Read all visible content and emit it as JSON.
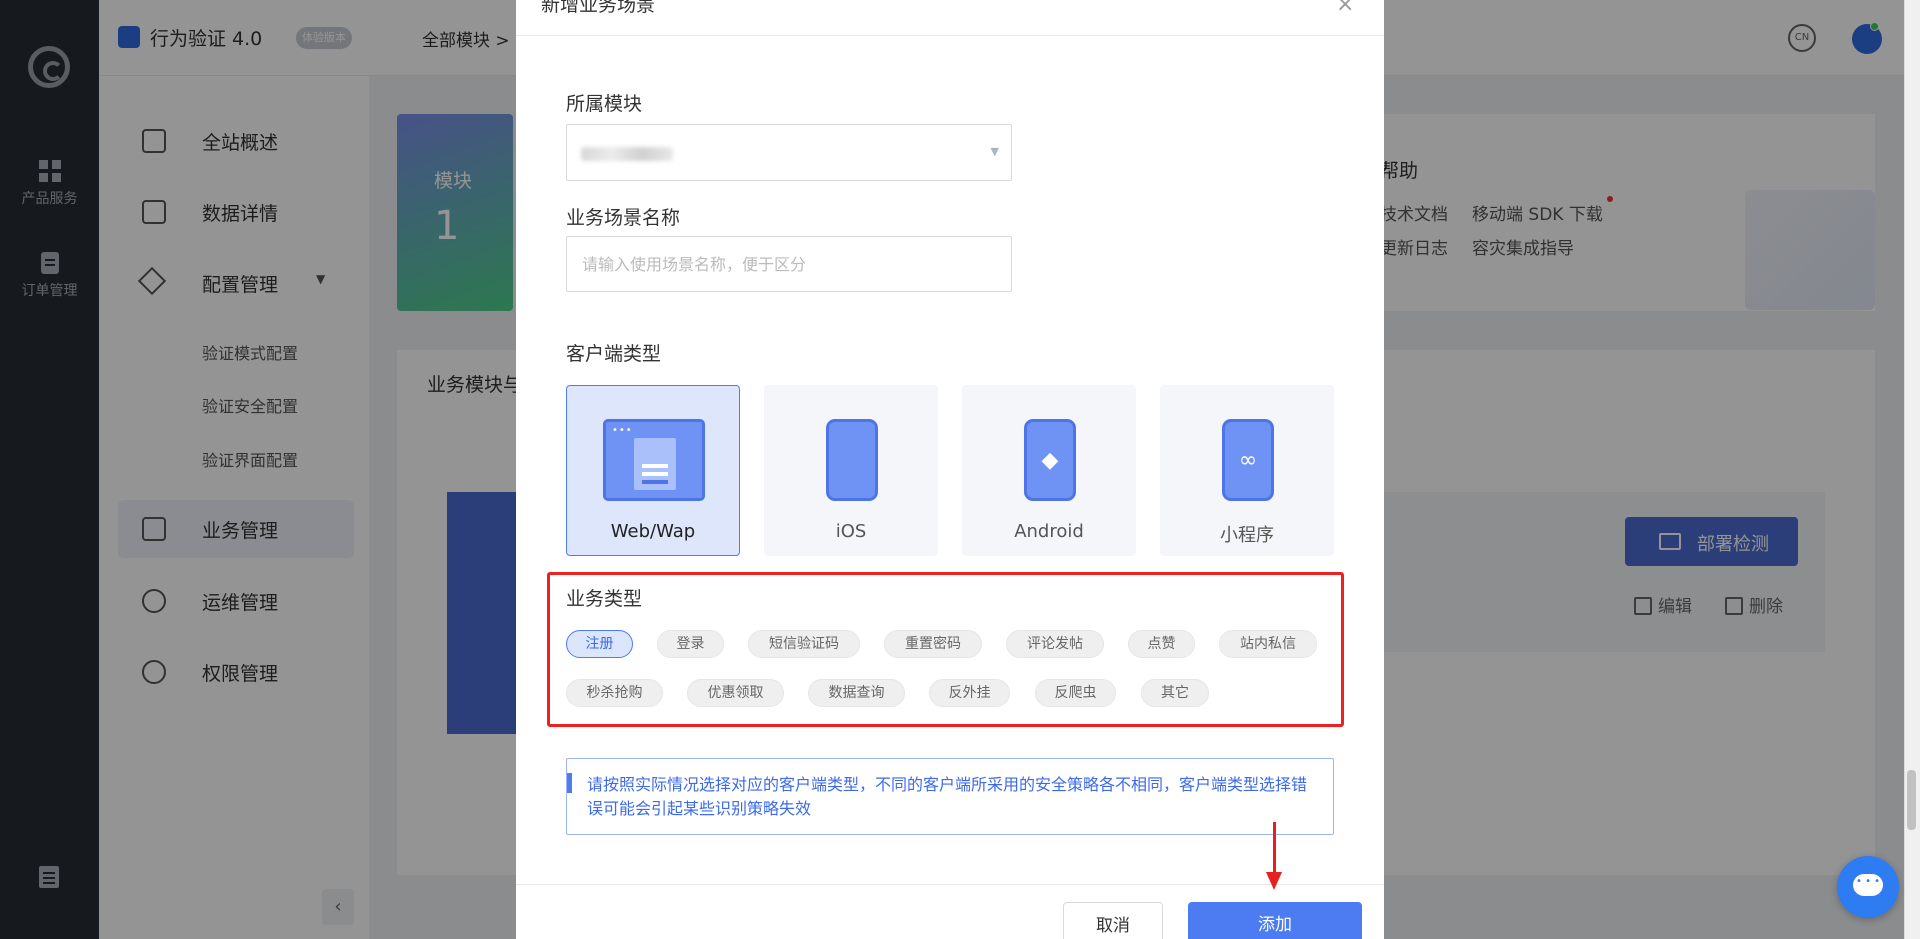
{
  "rail": {
    "items": [
      {
        "label": "产品服务",
        "icon": "grid-icon"
      },
      {
        "label": "订单管理",
        "icon": "clipboard-icon"
      }
    ]
  },
  "header": {
    "brand_title": "行为验证 4.0",
    "brand_badge": "体验版本",
    "breadcrumb": "全部模块 >",
    "lang_label": "CN"
  },
  "sidebar": {
    "items": [
      {
        "label": "全站概述",
        "icon": "overview-icon"
      },
      {
        "label": "数据详情",
        "icon": "chart-image-icon"
      },
      {
        "label": "配置管理",
        "icon": "triangle-config-icon"
      },
      {
        "label": "业务管理",
        "icon": "archive-box-icon"
      },
      {
        "label": "运维管理",
        "icon": "gear-icon"
      },
      {
        "label": "权限管理",
        "icon": "shield-icon"
      }
    ],
    "sub_items": [
      "验证模式配置",
      "验证安全配置",
      "验证界面配置"
    ],
    "collapse_label": "‹"
  },
  "background": {
    "stat_label": "模块",
    "stat_value": "1",
    "help_title": "帮助",
    "help_links": [
      "技术文档",
      "移动端 SDK 下载",
      "更新日志",
      "容灾集成指导"
    ],
    "panel_title": "业务模块与",
    "deploy_button": "部署检测",
    "edit_label": "编辑",
    "delete_label": "删除"
  },
  "modal": {
    "title": "新增业务场景",
    "close_label": "×",
    "module_label": "所属模块",
    "module_caret": "▼",
    "scene_name_label": "业务场景名称",
    "scene_name_placeholder": "请输入使用场景名称，便于区分",
    "client_type_label": "客户端类型",
    "client_types": [
      {
        "label": "Web/Wap",
        "selected": true
      },
      {
        "label": "iOS",
        "selected": false
      },
      {
        "label": "Android",
        "selected": false
      },
      {
        "label": "小程序",
        "selected": false
      }
    ],
    "business_type_label": "业务类型",
    "business_types_row1": [
      "注册",
      "登录",
      "短信验证码",
      "重置密码",
      "评论发帖",
      "点赞",
      "站内私信"
    ],
    "business_types_row2": [
      "秒杀抢购",
      "优惠领取",
      "数据查询",
      "反外挂",
      "反爬虫",
      "其它"
    ],
    "selected_business_type": "注册",
    "notice": "请按照实际情况选择对应的客户端类型，不同的客户端所采用的安全策略各不相同，客户端类型选择错误可能会引起某些识别策略失效",
    "cancel_button": "取消",
    "add_button": "添加"
  },
  "colors": {
    "accent": "#4d7cf2",
    "highlight_border": "#ee2020",
    "rail_bg": "#262b33"
  }
}
